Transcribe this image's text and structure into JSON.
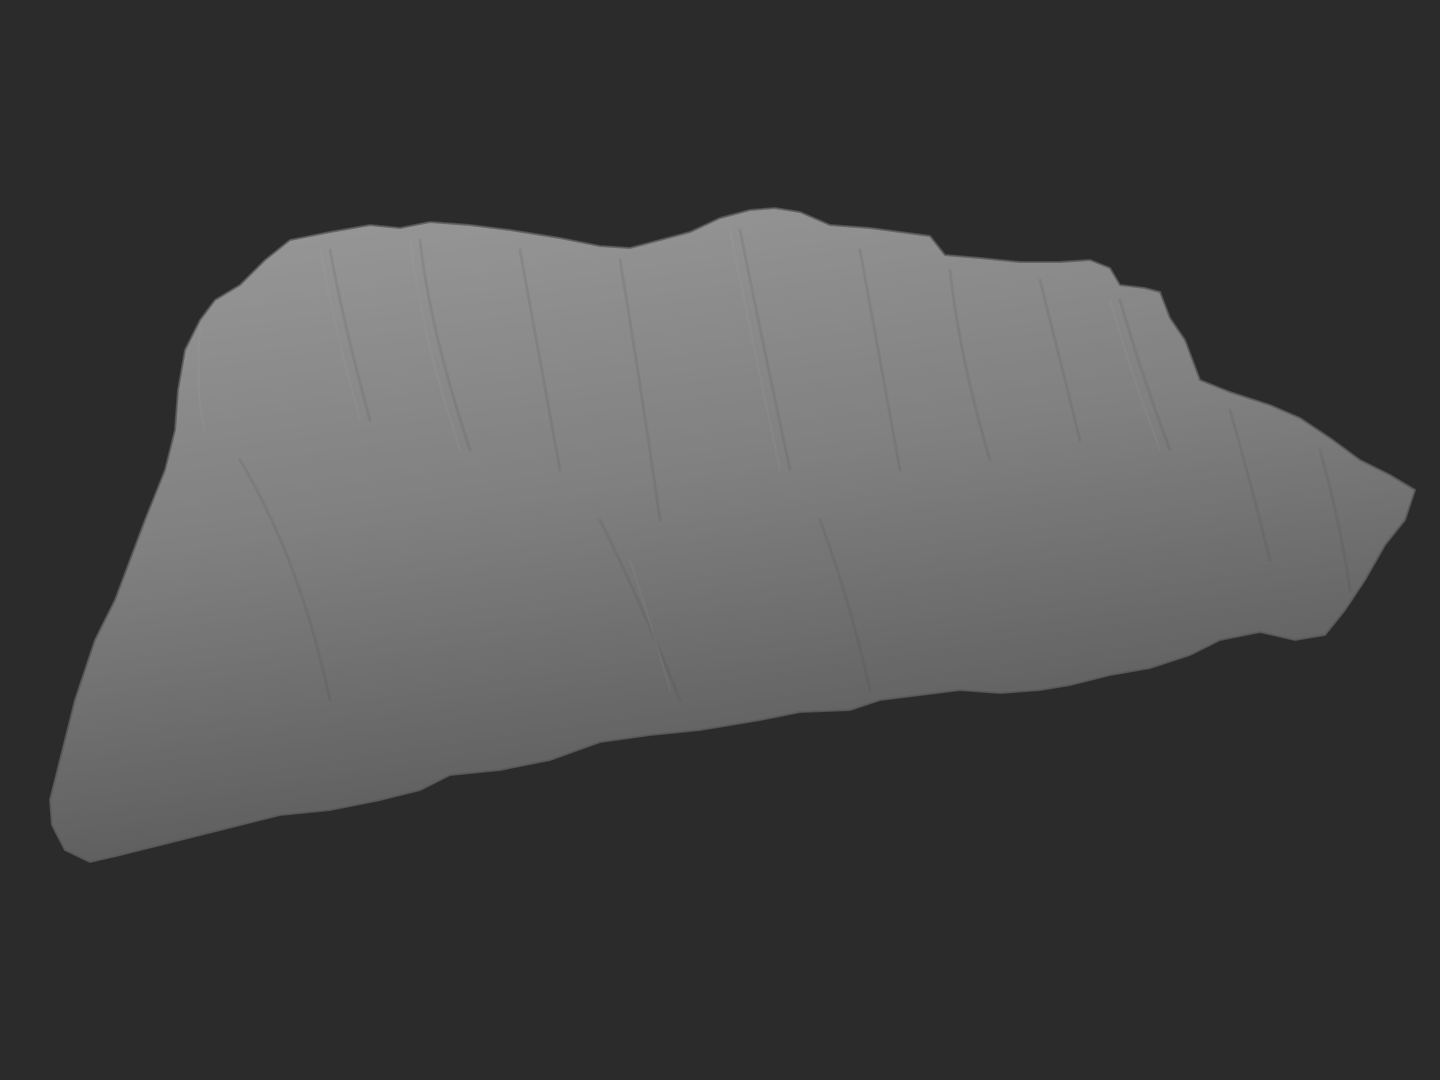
{
  "viewport": {
    "background_color": "#2b2b2c",
    "subject": "rock-sculpt-mesh",
    "mesh_colors": {
      "highlight": "#b4b4b4",
      "base": "#7c7c7c",
      "shadow": "#3a3a3a"
    }
  }
}
